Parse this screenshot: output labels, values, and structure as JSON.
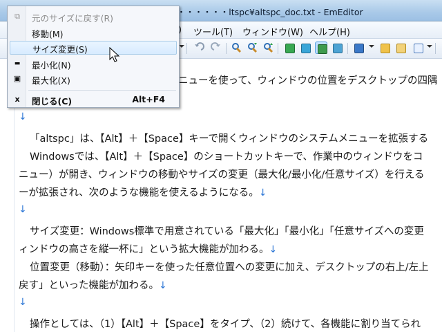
{
  "window": {
    "title": "ｰ・・・・・・・・・・・・・・ltspc¥altspc_doc.txt - EmEditor"
  },
  "menubar": {
    "items": [
      {
        "label": ")"
      },
      {
        "label": "ツール(T)"
      },
      {
        "label": "ウィンドウ(W)"
      },
      {
        "label": "ヘルプ(H)"
      }
    ]
  },
  "toolbar": {
    "icons": [
      "undo-icon",
      "redo-icon",
      "find-icon",
      "find-next-icon",
      "find-prev-icon",
      "view-icon",
      "view2-icon",
      "wrap-icon",
      "window-icon",
      "marker-icon",
      "macro-icon",
      "properties-icon",
      "checkbox-icon"
    ]
  },
  "system_menu": {
    "items": [
      {
        "icon": "restore-icon",
        "glyph": "⧉",
        "label": "元のサイズに戻す(R)",
        "disabled": true
      },
      {
        "icon": "",
        "glyph": "",
        "label": "移動(M)",
        "disabled": false
      },
      {
        "icon": "",
        "glyph": "",
        "label": "サイズ変更(S)",
        "disabled": false,
        "highlighted": true
      },
      {
        "icon": "minimize-icon",
        "glyph": "▬",
        "label": "最小化(N)",
        "disabled": false
      },
      {
        "icon": "maximize-icon",
        "glyph": "▣",
        "label": "最大化(X)",
        "disabled": false
      },
      {
        "icon": "close-icon",
        "glyph": "x",
        "label": "閉じる(C)",
        "accelerator": "Alt+F4",
        "bold": true
      }
    ]
  },
  "editor": {
    "eol_mark": "↓",
    "lines": [
      "ニューを使って、ウィンドウの位置をデスクトップの四隅",
      "",
      "「altspc」は、【Alt】＋【Space】キーで開くウィンドウのシステムメニューを拡張する",
      "Windowsでは、【Alt】＋【Space】のショートカットキーで、作業中のウィンドウをコ",
      "ニュー）が開き、ウィンドウの移動やサイズの変更（最大化/最小化/任意サイズ）を行える",
      "ーが拡張され、次のような機能を使えるようになる。",
      "",
      "サイズ変更：Windows標準で用意されている「最大化」「最小化」「任意サイズへの変更",
      "ィンドウの高さを縦一杯に」という拡大機能が加わる。",
      "位置変更（移動）：矢印キーを使った任意位置への変更に加え、デスクトップの右上/左上",
      "戻す」といった機能が加わる。",
      "",
      "操作としては、（1）【Alt】＋【Space】をタイプ、（2）続けて、各機能に割り当てられ"
    ]
  }
}
